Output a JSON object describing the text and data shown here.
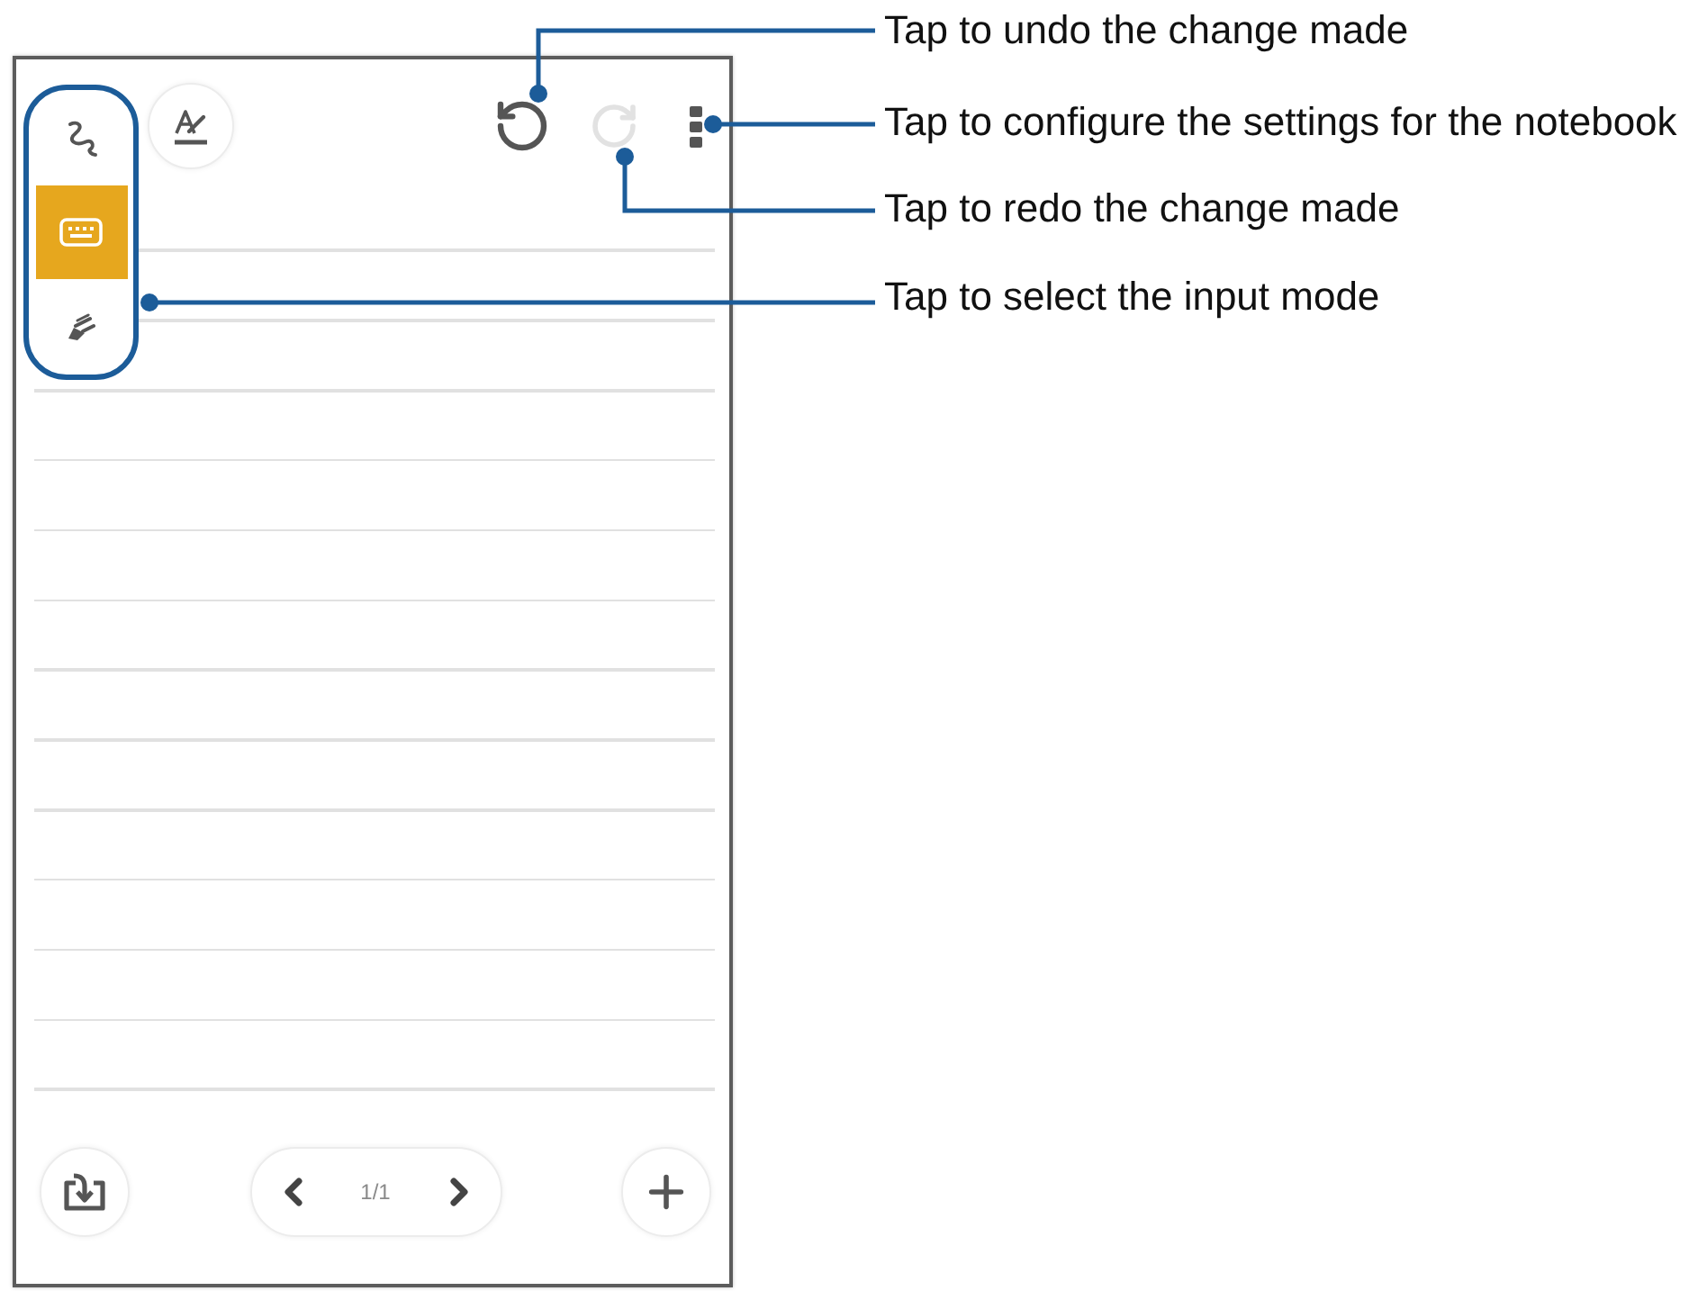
{
  "notebook": {
    "input_modes": [
      {
        "kind": "handwriting",
        "selected": false
      },
      {
        "kind": "keyboard",
        "selected": true
      },
      {
        "kind": "brush",
        "selected": false
      }
    ],
    "toolbar": [
      {
        "kind": "pen_style",
        "disabled": false
      },
      {
        "kind": "undo",
        "disabled": false
      },
      {
        "kind": "redo",
        "disabled": true
      },
      {
        "kind": "menu",
        "disabled": false
      }
    ],
    "bottom_bar": [
      {
        "kind": "import"
      },
      {
        "kind": "pager",
        "page": "1/1"
      },
      {
        "kind": "add"
      }
    ]
  },
  "callouts": [
    {
      "kind": "undo",
      "text": "Tap to undo the change made"
    },
    {
      "kind": "settings",
      "text": "Tap to configure the settings for the notebook"
    },
    {
      "kind": "redo",
      "text": "Tap to redo the change made"
    },
    {
      "kind": "input_mode",
      "text": "Tap to select the input mode"
    }
  ]
}
